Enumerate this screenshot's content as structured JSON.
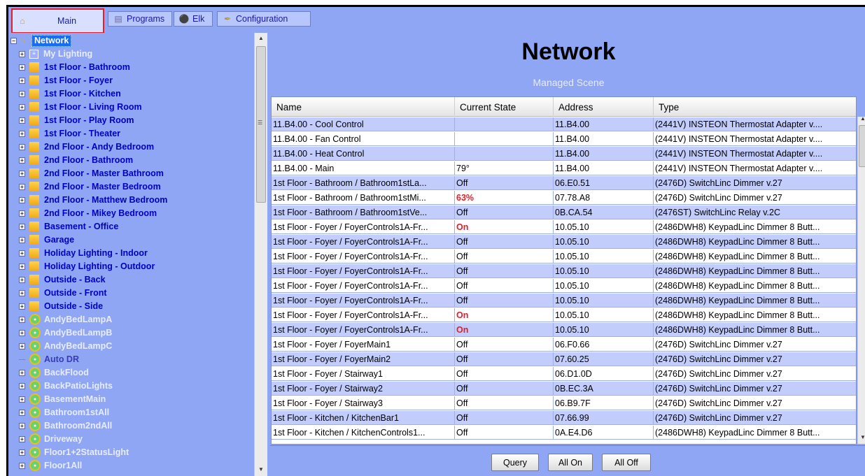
{
  "tabs": [
    {
      "label": "Main",
      "icon": "home-icon"
    },
    {
      "label": "Programs",
      "icon": "program-icon"
    },
    {
      "label": "Elk",
      "icon": "shield-icon"
    },
    {
      "label": "Configuration",
      "icon": "wrench-icon"
    }
  ],
  "tree": {
    "root": "Network",
    "items": [
      {
        "label": "My Lighting",
        "kind": "list",
        "expandable": true
      },
      {
        "label": "1st Floor - Bathroom",
        "kind": "folder",
        "expandable": true
      },
      {
        "label": "1st Floor - Foyer",
        "kind": "folder",
        "expandable": true
      },
      {
        "label": "1st Floor - Kitchen",
        "kind": "folder",
        "expandable": true
      },
      {
        "label": "1st Floor - Living Room",
        "kind": "folder",
        "expandable": true
      },
      {
        "label": "1st Floor - Play Room",
        "kind": "folder",
        "expandable": true
      },
      {
        "label": "1st Floor - Theater",
        "kind": "folder",
        "expandable": true
      },
      {
        "label": "2nd Floor - Andy Bedroom",
        "kind": "folder",
        "expandable": true
      },
      {
        "label": "2nd Floor - Bathroom",
        "kind": "folder",
        "expandable": true
      },
      {
        "label": "2nd Floor - Master Bathroom",
        "kind": "folder",
        "expandable": true
      },
      {
        "label": "2nd Floor - Master Bedroom",
        "kind": "folder",
        "expandable": true
      },
      {
        "label": "2nd Floor - Matthew Bedroom",
        "kind": "folder",
        "expandable": true
      },
      {
        "label": "2nd Floor - Mikey Bedroom",
        "kind": "folder",
        "expandable": true
      },
      {
        "label": "Basement - Office",
        "kind": "folder",
        "expandable": true
      },
      {
        "label": "Garage",
        "kind": "folder",
        "expandable": true
      },
      {
        "label": "Holiday Lighting - Indoor",
        "kind": "folder",
        "expandable": true
      },
      {
        "label": "Holiday Lighting - Outdoor",
        "kind": "folder",
        "expandable": true
      },
      {
        "label": "Outside - Back",
        "kind": "folder",
        "expandable": true
      },
      {
        "label": "Outside - Front",
        "kind": "folder",
        "expandable": true
      },
      {
        "label": "Outside - Side",
        "kind": "folder",
        "expandable": true
      },
      {
        "label": "AndyBedLampA",
        "kind": "scene",
        "expandable": true
      },
      {
        "label": "AndyBedLampB",
        "kind": "scene",
        "expandable": true
      },
      {
        "label": "AndyBedLampC",
        "kind": "scene",
        "expandable": true
      },
      {
        "label": "Auto DR",
        "kind": "scene",
        "expandable": false
      },
      {
        "label": "BackFlood",
        "kind": "scene",
        "expandable": true
      },
      {
        "label": "BackPatioLights",
        "kind": "scene",
        "expandable": true
      },
      {
        "label": "BasementMain",
        "kind": "scene",
        "expandable": true
      },
      {
        "label": "Bathroom1stAll",
        "kind": "scene",
        "expandable": true
      },
      {
        "label": "Bathroom2ndAll",
        "kind": "scene",
        "expandable": true
      },
      {
        "label": "Driveway",
        "kind": "scene",
        "expandable": true
      },
      {
        "label": "Floor1+2StatusLight",
        "kind": "scene",
        "expandable": true
      },
      {
        "label": "Floor1All",
        "kind": "scene",
        "expandable": true
      }
    ]
  },
  "panel": {
    "title": "Network",
    "subtitle": "Managed Scene"
  },
  "table": {
    "columns": [
      "Name",
      "Current State",
      "Address",
      "Type"
    ],
    "rows": [
      [
        "11.B4.00 - Cool Control",
        "",
        "11.B4.00",
        "(2441V) INSTEON Thermostat Adapter v...."
      ],
      [
        "11.B4.00 - Fan Control",
        "",
        "11.B4.00",
        "(2441V) INSTEON Thermostat Adapter v...."
      ],
      [
        "11.B4.00 - Heat Control",
        "",
        "11.B4.00",
        "(2441V) INSTEON Thermostat Adapter v...."
      ],
      [
        "11.B4.00 - Main",
        "79°",
        "11.B4.00",
        "(2441V) INSTEON Thermostat Adapter v...."
      ],
      [
        "1st Floor - Bathroom / Bathroom1stLa...",
        "Off",
        "06.E0.51",
        "(2476D) SwitchLinc Dimmer v.27"
      ],
      [
        "1st Floor - Bathroom / Bathroom1stMi...",
        "63%",
        "07.78.A8",
        "(2476D) SwitchLinc Dimmer v.27"
      ],
      [
        "1st Floor - Bathroom / Bathroom1stVe...",
        "Off",
        "0B.CA.54",
        "(2476ST) SwitchLinc Relay v.2C"
      ],
      [
        "1st Floor - Foyer / FoyerControls1A-Fr...",
        "On",
        "10.05.10",
        "(2486DWH8) KeypadLinc Dimmer 8 Butt..."
      ],
      [
        "1st Floor - Foyer / FoyerControls1A-Fr...",
        "Off",
        "10.05.10",
        "(2486DWH8) KeypadLinc Dimmer 8 Butt..."
      ],
      [
        "1st Floor - Foyer / FoyerControls1A-Fr...",
        "Off",
        "10.05.10",
        "(2486DWH8) KeypadLinc Dimmer 8 Butt..."
      ],
      [
        "1st Floor - Foyer / FoyerControls1A-Fr...",
        "Off",
        "10.05.10",
        "(2486DWH8) KeypadLinc Dimmer 8 Butt..."
      ],
      [
        "1st Floor - Foyer / FoyerControls1A-Fr...",
        "Off",
        "10.05.10",
        "(2486DWH8) KeypadLinc Dimmer 8 Butt..."
      ],
      [
        "1st Floor - Foyer / FoyerControls1A-Fr...",
        "Off",
        "10.05.10",
        "(2486DWH8) KeypadLinc Dimmer 8 Butt..."
      ],
      [
        "1st Floor - Foyer / FoyerControls1A-Fr...",
        "On",
        "10.05.10",
        "(2486DWH8) KeypadLinc Dimmer 8 Butt..."
      ],
      [
        "1st Floor - Foyer / FoyerControls1A-Fr...",
        "On",
        "10.05.10",
        "(2486DWH8) KeypadLinc Dimmer 8 Butt..."
      ],
      [
        "1st Floor - Foyer / FoyerMain1",
        "Off",
        "06.F0.66",
        "(2476D) SwitchLinc Dimmer v.27"
      ],
      [
        "1st Floor - Foyer / FoyerMain2",
        "Off",
        "07.60.25",
        "(2476D) SwitchLinc Dimmer v.27"
      ],
      [
        "1st Floor - Foyer / Stairway1",
        "Off",
        "06.D1.0D",
        "(2476D) SwitchLinc Dimmer v.27"
      ],
      [
        "1st Floor - Foyer / Stairway2",
        "Off",
        "0B.EC.3A",
        "(2476D) SwitchLinc Dimmer v.27"
      ],
      [
        "1st Floor - Foyer / Stairway3",
        "Off",
        "06.B9.7F",
        "(2476D) SwitchLinc Dimmer v.27"
      ],
      [
        "1st Floor - Kitchen / KitchenBar1",
        "Off",
        "07.66.99",
        "(2476D) SwitchLinc Dimmer v.27"
      ],
      [
        "1st Floor - Kitchen / KitchenControls1...",
        "Off",
        "0A.E4.D6",
        "(2486DWH8) KeypadLinc Dimmer 8 Butt..."
      ]
    ],
    "highlight_states": [
      "On",
      "63%"
    ]
  },
  "buttons": {
    "query": "Query",
    "all_on": "All On",
    "all_off": "All Off"
  },
  "colors": {
    "background": "#8fa6f5",
    "selected_tab_outline": "#e0202a",
    "state_on": "#e0202a",
    "alt_row": "#c3cdfb"
  }
}
